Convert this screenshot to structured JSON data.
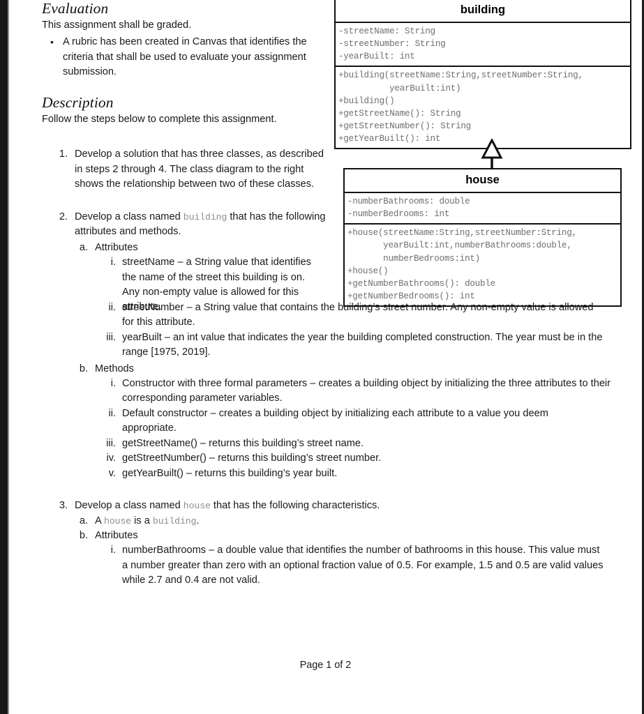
{
  "document": {
    "sections": [
      {
        "heading": "Evaluation",
        "intro": "This assignment shall be graded.",
        "bullets": [
          {
            "marker": "•",
            "text": "A rubric has been created in Canvas that identifies the criteria that shall be used to evaluate your assignment submission."
          }
        ]
      },
      {
        "heading": "Description",
        "intro": "Follow the steps below to complete this assignment."
      }
    ],
    "steps": [
      {
        "marker": "1.",
        "text": "Develop a solution that has three classes, as described in steps 2 through 4. The class diagram to the right shows the relationship between two of these classes."
      },
      {
        "marker": "2.",
        "text_before": "Develop a class named",
        "code": "building",
        "text_after": "that has the following attributes and methods.",
        "sub": [
          {
            "marker": "a.",
            "text": "Attributes",
            "roman": [
              {
                "marker": "i.",
                "text": "streetName – a String value that identifies the name of the street this building is on. Any non-empty value is allowed for this attribute."
              },
              {
                "marker": "ii.",
                "text": "streetNumber – a String value that contains the building’s street number. Any non-empty value is allowed for this attribute."
              },
              {
                "marker": "iii.",
                "text": "yearBuilt – an int value that indicates the year the building completed construction. The year must be in the range [1975, 2019]."
              }
            ]
          },
          {
            "marker": "b.",
            "text": "Methods",
            "roman": [
              {
                "marker": "i.",
                "text": "Constructor with three formal parameters – creates a building object by initializing the three attributes to their corresponding parameter variables."
              },
              {
                "marker": "ii.",
                "text": "Default constructor – creates a building object by initializing each attribute to a value you deem appropriate."
              },
              {
                "marker": "iii.",
                "text": "getStreetName() – returns this building’s street name."
              },
              {
                "marker": "iv.",
                "text": "getStreetNumber() – returns this building’s street number."
              },
              {
                "marker": "v.",
                "text": "getYearBuilt() – returns this building’s year built."
              }
            ]
          }
        ]
      },
      {
        "marker": "3.",
        "text_before": "Develop a class named",
        "code": "house",
        "text_after": "that has the following characteristics.",
        "sub_a": {
          "marker": "a.",
          "prefix": "A",
          "code1": "house",
          "middle": "is a",
          "code2": "building",
          "suffix": "."
        },
        "sub_b": {
          "marker": "b.",
          "text": "Attributes",
          "roman": [
            {
              "marker": "i.",
              "text": "numberBathrooms – a double value that identifies the number of bathrooms in this house. This value must a number greater than zero with an optional fraction value of 0.5. For example, 1.5 and 0.5 are valid values while 2.7 and 0.4 are not valid."
            }
          ]
        }
      }
    ],
    "footer": "Page 1 of 2"
  },
  "class_diagram": {
    "relationship": "generalization",
    "classes": [
      {
        "name": "building",
        "attributes": [
          "-streetName: String",
          "-streetNumber: String",
          "-yearBuilt: int"
        ],
        "methods": [
          "+building(streetName:String,streetNumber:String,",
          "          yearBuilt:int)",
          "+building()",
          "+getStreetName(): String",
          "+getStreetNumber(): String",
          "+getYearBuilt(): int"
        ]
      },
      {
        "name": "house",
        "attributes": [
          "-numberBathrooms: double",
          "-numberBedrooms: int"
        ],
        "methods": [
          "+house(streetName:String,streetNumber:String,",
          "       yearBuilt:int,numberBathrooms:double,",
          "       numberBedrooms:int)",
          "+house()",
          "+getNumberBathrooms(): double",
          "+getNumberBedrooms(): int"
        ]
      }
    ]
  }
}
